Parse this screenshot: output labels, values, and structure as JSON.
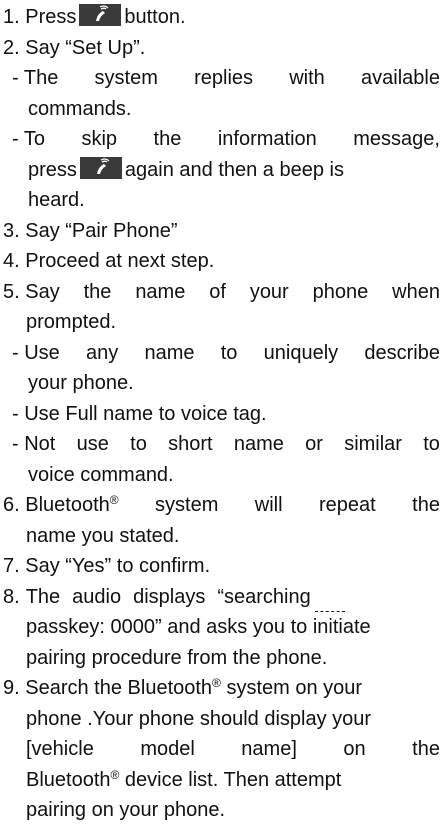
{
  "icons": {
    "voice_button": "voice-recognition-icon",
    "button_color": "#3a3a3a"
  },
  "steps": {
    "s1": {
      "num": "1.",
      "pre": "Press",
      "post": "button."
    },
    "s2": {
      "num": "2.",
      "text": "Say “Set Up”."
    },
    "s2_sub1": {
      "dash": "-",
      "words": [
        "The",
        "system",
        "replies",
        "with",
        "available"
      ],
      "cont": "commands."
    },
    "s2_sub2": {
      "dash": "-",
      "words": [
        "To",
        "skip",
        "the",
        "information",
        "message,"
      ],
      "pre2": "press",
      "post2": "again and then a beep is",
      "cont": "heard."
    },
    "s3": {
      "num": "3.",
      "text": "Say “Pair Phone”"
    },
    "s4": {
      "num": "4.",
      "text": "Proceed at next step."
    },
    "s5": {
      "num": "5.",
      "words": [
        "Say",
        "the",
        "name",
        "of",
        "your",
        "phone",
        "when"
      ],
      "cont": "prompted."
    },
    "s5_sub1": {
      "dash": "-",
      "words": [
        "Use",
        "any",
        "name",
        "to",
        "uniquely",
        "describe"
      ],
      "cont": "your phone."
    },
    "s5_sub2": {
      "dash": "-",
      "text": "Use Full name to voice tag."
    },
    "s5_sub3": {
      "dash": "-",
      "words": [
        "Not",
        "use",
        "to",
        "short",
        "name",
        "or",
        "similar",
        "to"
      ],
      "cont": "voice command."
    },
    "s6": {
      "num": "6.",
      "brand": "Bluetooth",
      "reg": "®",
      "words": [
        "system",
        "will",
        "repeat",
        "the"
      ],
      "cont": "name you stated."
    },
    "s7": {
      "num": "7.",
      "text": "Say “Yes” to confirm."
    },
    "s8": {
      "num": "8.",
      "words": [
        "The",
        "audio",
        "displays",
        "“searching"
      ],
      "cont1": "passkey: 0000” and asks you to initiate",
      "cont2": "pairing procedure from the phone."
    },
    "s9": {
      "num": "9.",
      "line1_pre": "Search the Bluetooth",
      "reg": "®",
      "line1_post": " system on your",
      "line2": "phone .Your phone should display your",
      "line3_words": [
        "[vehicle",
        "model",
        "name]",
        "on",
        "the"
      ],
      "line4_pre": "Bluetooth",
      "line4_post": " device list. Then attempt",
      "line5": "pairing on your phone."
    }
  }
}
